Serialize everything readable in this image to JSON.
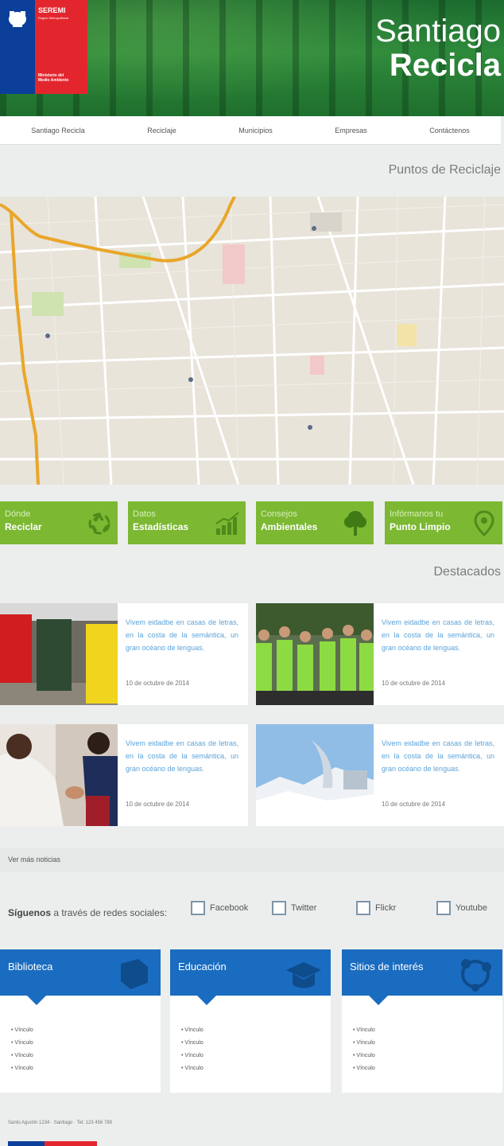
{
  "header": {
    "logo": {
      "seremi": "SEREMI",
      "region": "Región Metropolitana",
      "ministerio_line1": "Ministerio del",
      "ministerio_line2": "Medio Ambiente"
    },
    "brand_line1": "Santiago",
    "brand_line2": "Recicla"
  },
  "nav": [
    "Santiago Recicla",
    "Reciclaje",
    "Municipios",
    "Empresas",
    "Contáctenos"
  ],
  "map_section": {
    "title": "Puntos de Reciclaje"
  },
  "actions": [
    {
      "line1": "Dónde",
      "line2": "Reciclar",
      "icon": "recycle-icon"
    },
    {
      "line1": "Datos",
      "line2": "Estadísticas",
      "icon": "chart-icon"
    },
    {
      "line1": "Consejos",
      "line2": "Ambientales",
      "icon": "tree-icon"
    },
    {
      "line1": "Infórmanos tu",
      "line2": "Punto Limpio",
      "icon": "location-pin-icon"
    }
  ],
  "featured": {
    "title": "Destacados",
    "items": [
      {
        "text": "Vivem eidadbe en casas de letras, en la costa de la semántica, un gran océano de lenguas.",
        "date": "10 de octubre de 2014"
      },
      {
        "text": "Vivem eidadbe en casas de letras, en la costa de la semántica, un gran océano de lenguas.",
        "date": "10 de octubre de 2014"
      },
      {
        "text": "Vivem eidadbe en casas de letras, en la costa de la semántica, un gran océano de lenguas.",
        "date": "10 de octubre de 2014"
      },
      {
        "text": "Vivem eidadbe en casas de letras, en la costa de la semántica, un gran océano de lenguas.",
        "date": "10 de octubre de 2014"
      }
    ],
    "more": "Ver más noticias"
  },
  "social": {
    "follow_bold": "Síguenos",
    "follow_rest": " a través de redes sociales:",
    "networks": [
      "Facebook",
      "Twitter",
      "Flickr",
      "Youtube"
    ]
  },
  "boxes": [
    {
      "title": "Biblioteca",
      "links": [
        "Vínculo",
        "Vínculo",
        "Vínculo",
        "Vínculo"
      ],
      "icon": "book-icon"
    },
    {
      "title": "Educación",
      "links": [
        "Vínculo",
        "Vínculo",
        "Vínculo",
        "Vínculo"
      ],
      "icon": "graduation-cap-icon"
    },
    {
      "title": "Sitios de interés",
      "links": [
        "Vínculo",
        "Vínculo",
        "Vínculo",
        "Vínculo"
      ],
      "icon": "network-icon"
    }
  ],
  "footer": {
    "text": "Santo Agustín 1234 · Santiago · Tel: 123 456 789"
  },
  "colors": {
    "green": "#7cb832",
    "blue": "#1a6cc0",
    "link": "#5ba3d9",
    "header_green": "#2e8a3b"
  }
}
